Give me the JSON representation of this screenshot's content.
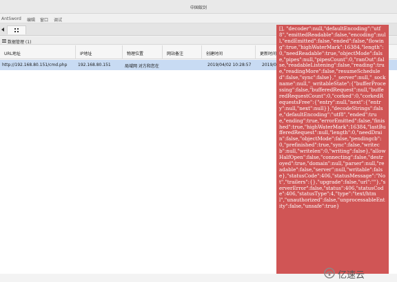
{
  "window": {
    "title": "中国蚁剑"
  },
  "menu": {
    "items": [
      "AntSword",
      "编辑",
      "窗口",
      "调试"
    ]
  },
  "panel": {
    "title": "数据管理 (1)"
  },
  "table": {
    "headers": [
      "URL地址",
      "IP地址",
      "物理位置",
      "网站备注",
      "创建时间",
      "更新时间"
    ],
    "rows": [
      [
        "http://192.168.80.151/cmd.php",
        "192.168.80.151",
        "局域网 对方和您在",
        "",
        "2019/04/02 10:28:57",
        "2019/04/15 10:53:55"
      ]
    ]
  },
  "error": {
    "text": "[], \"decoder\":null,\"defaultEncoding\":\"utf8\",\"emittedReadable\":false,\"encoding\":null,\"endEmitted\":false,\"ended\":false,\"flowing\":true,\"highWaterMark\":16384,\"length\":0,\"needReadable\":true,\"objectMode\":false,\"pipes\":null,\"pipesCount\":0,\"ranOut\":false,\"readableListening\":false,\"reading\":true,\"readingMore\":false,\"resumeScheduled\":false,\"sync\":false},\"_server\":null,\"_sockname\":null,\"_writableState\":{\"bufferProcessing\":false,\"bufferedRequest\":null,\"bufferedRequestCount\":0,\"corked\":0,\"corkedRequestsFree\":{\"entry\":null,\"next\":{\"entry\":null,\"next\":null}},\"decodeStrings\":false,\"defaultEncoding\":\"utf8\",\"ended\":true,\"ending\":true,\"errorEmitted\":false,\"finished\":true,\"highWaterMark\":16384,\"lastBufferedRequest\":null,\"length\":0,\"needDrain\":false,\"objectMode\":false,\"pendingcb\":0,\"prefinished\":true,\"sync\":false,\"writecb\":null,\"writelen\":0,\"writing\":false},\"allowHalfOpen\":false,\"connecting\":false,\"destroyed\":true,\"domain\":null,\"parser\":null,\"readable\":false,\"server\":null,\"writable\":false},\"statusCode\":406,\"statusMessage\":\"Not\",\"trailers\":{},\"upgrade\":false,\"url\":\"\"},\"serverError\":false,\"status\":406,\"statusCode\":406,\"statusType\":4,\"type\":\"text/html\",\"unauthorized\":false,\"unprocessableEntity\":false,\"unsafe\":true}"
  },
  "watermark": {
    "text": "亿速云"
  },
  "colors": {
    "error_bg": "#d05555",
    "row_selected": "#c8dbf3"
  }
}
